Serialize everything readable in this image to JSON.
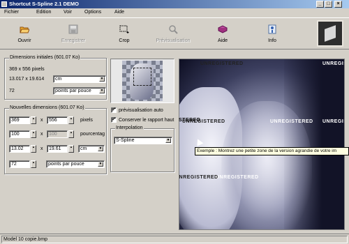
{
  "window": {
    "title": "Shortcut S-Spline 2.1 DEMO",
    "min": "_",
    "max": "□",
    "close": "×"
  },
  "menu": [
    "Fichier",
    "Edition",
    "Voir",
    "Options",
    "Aide"
  ],
  "toolbar": {
    "open": "Ouvrir",
    "save": "Enregistrer",
    "crop": "Crop",
    "preview": "Prévisualisation",
    "help": "Aide",
    "info": "Info"
  },
  "initial": {
    "legend": "Dimensions initiales (601.07 Ko)",
    "pixels": "369 x 556 pixels",
    "size": "13.017 x 19.614",
    "unit": "cm",
    "res": "72",
    "res_unit": "points par pouce"
  },
  "newdims": {
    "legend": "Nouvelles dimensions (601.07 Ko)",
    "w_px": "369",
    "h_px": "556",
    "px_unit": "pixels",
    "w_pct": "100",
    "h_pct": "100",
    "pct_unit": "pourcentag",
    "w_cm": "13.02",
    "h_cm": "19.61",
    "cm_unit": "cm",
    "res": "72",
    "res_unit": "points par pouce",
    "x": "x"
  },
  "options": {
    "auto_preview": "prévisualisation auto",
    "keep_ratio": "Conserver le rapport haut",
    "interp_legend": "Interpolation",
    "interp_value": "S-Spline"
  },
  "watermark": "UNREGISTERED",
  "watermark_partial": "STERED",
  "tooltip": "Exemple : Montrez une petite zone de la version agrandie de votre im",
  "status": "Model 10 copie.bmp",
  "check_mark": "✓",
  "arrow_down": "▼",
  "arrow_up": "▲"
}
